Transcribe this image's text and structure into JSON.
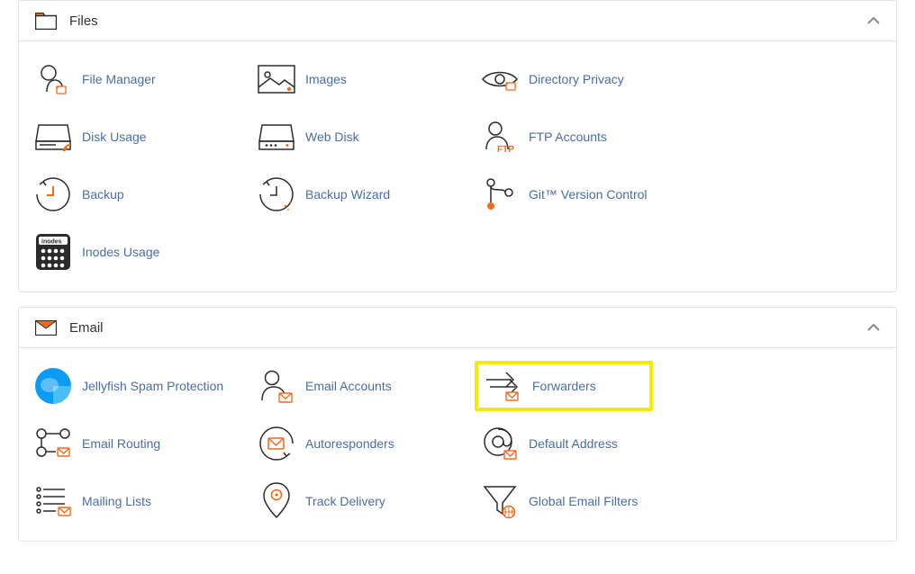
{
  "panels": {
    "files": {
      "title": "Files",
      "items": {
        "file_manager": "File Manager",
        "images": "Images",
        "directory_privacy": "Directory Privacy",
        "disk_usage": "Disk Usage",
        "web_disk": "Web Disk",
        "ftp_accounts": "FTP Accounts",
        "backup": "Backup",
        "backup_wizard": "Backup Wizard",
        "git": "Git™ Version Control",
        "inodes": "Inodes Usage"
      }
    },
    "email": {
      "title": "Email",
      "items": {
        "jellyfish": "Jellyfish Spam Protection",
        "email_accounts": "Email Accounts",
        "forwarders": "Forwarders",
        "email_routing": "Email Routing",
        "autoresponders": "Autoresponders",
        "default_address": "Default Address",
        "mailing_lists": "Mailing Lists",
        "track_delivery": "Track Delivery",
        "global_filters": "Global Email Filters"
      }
    }
  }
}
